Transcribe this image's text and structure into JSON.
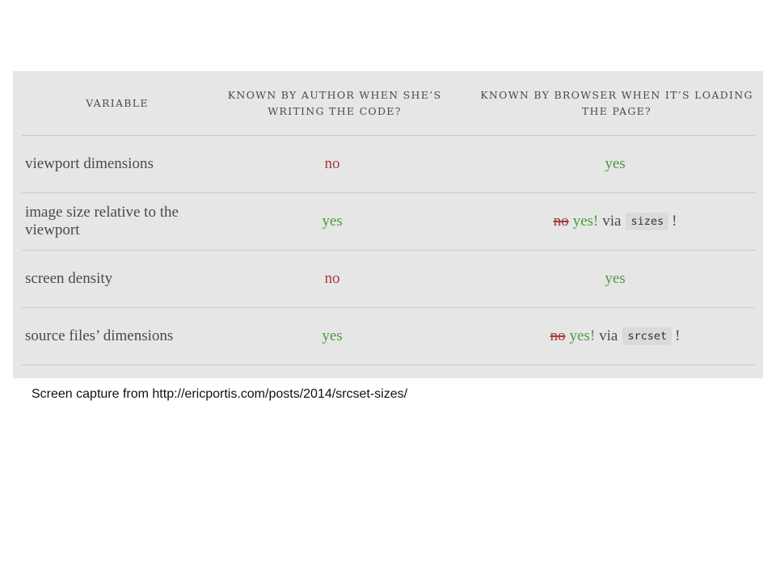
{
  "table": {
    "headers": [
      "VARIABLE",
      "KNOWN BY AUTHOR WHEN SHE’S WRITING THE CODE?",
      "KNOWN BY BROWSER WHEN IT’S LOADING THE PAGE?"
    ],
    "rows": [
      {
        "variable": "viewport dimensions",
        "author": "no",
        "browser": "yes"
      },
      {
        "variable": "image size relative to the viewport",
        "author": "yes",
        "browser_struck": "no",
        "browser_yes": "yes!",
        "browser_via": "via",
        "browser_code": "sizes",
        "browser_bang": "!"
      },
      {
        "variable": "screen density",
        "author": "no",
        "browser": "yes"
      },
      {
        "variable": "source files’ dimensions",
        "author": "yes",
        "browser_struck": "no",
        "browser_yes": "yes!",
        "browser_via": "via",
        "browser_code": "srcset",
        "browser_bang": "!"
      }
    ]
  },
  "caption": "Screen capture from http://ericportis.com/posts/2014/srcset-sizes/",
  "colors": {
    "no": "#a83a3a",
    "yes": "#4e9a3e",
    "panel": "#e6e6e6"
  }
}
